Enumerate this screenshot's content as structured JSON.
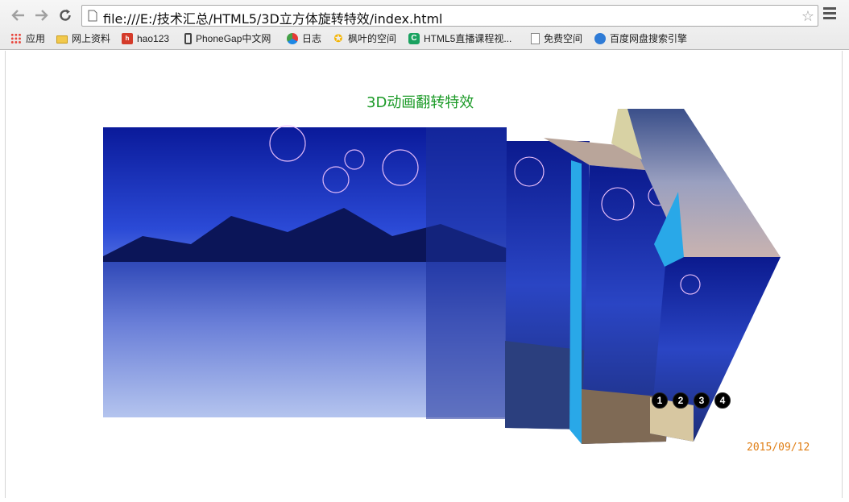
{
  "browser": {
    "url": "file:///E:/技术汇总/HTML5/3D立方体旋转特效/index.html",
    "bookmarks": [
      {
        "label": "应用",
        "icon": "apps-grid-icon"
      },
      {
        "label": "网上资料",
        "icon": "folder-icon"
      },
      {
        "label": "hao123",
        "icon": "hao123-icon"
      },
      {
        "label": "PhoneGap中文网",
        "icon": "phone-icon"
      },
      {
        "label": "日志",
        "icon": "colorful-dots-icon"
      },
      {
        "label": "枫叶的空间",
        "icon": "star-icon"
      },
      {
        "label": "HTML5直播课程视...",
        "icon": "green-c-icon"
      },
      {
        "label": "免费空间",
        "icon": "document-icon"
      },
      {
        "label": "百度网盘搜索引擎",
        "icon": "baidu-cloud-icon"
      }
    ]
  },
  "page": {
    "title": "3D动画翻转特效",
    "date": "2015/09/12",
    "pager": [
      "1",
      "2",
      "3",
      "4"
    ]
  },
  "colors": {
    "title": "#1b9a27",
    "date": "#e07e14",
    "cube_accent": "#29a8e8"
  }
}
